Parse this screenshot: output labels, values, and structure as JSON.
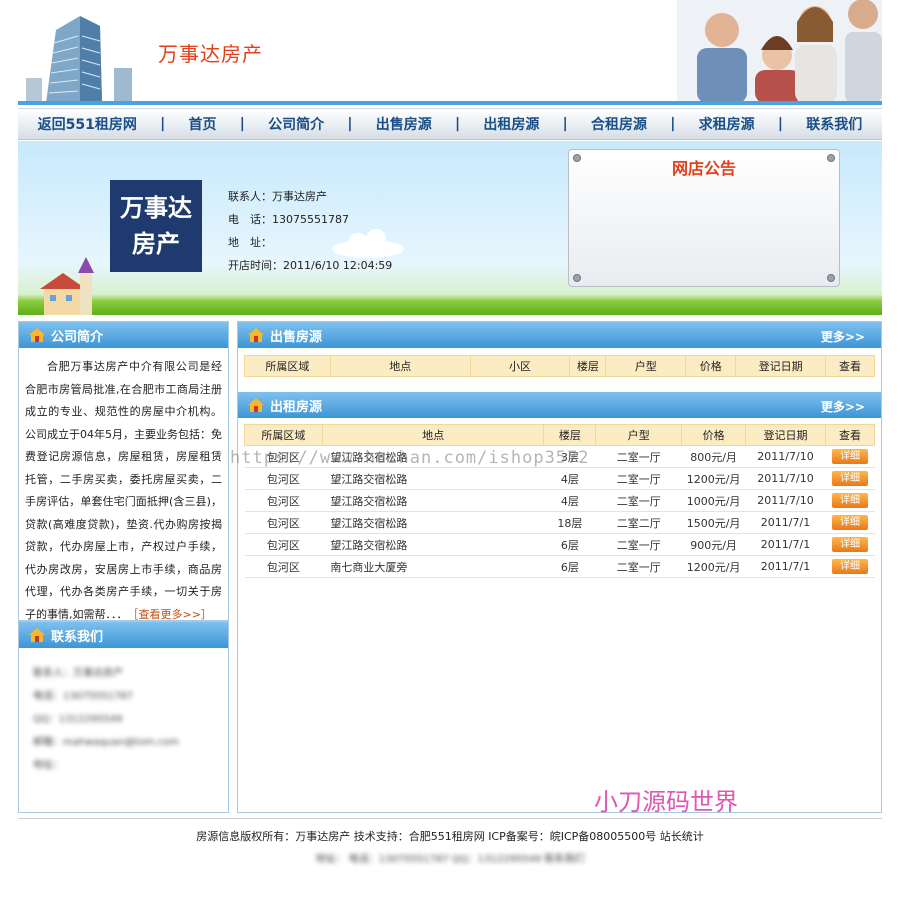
{
  "header": {
    "site_title": "万事达房产"
  },
  "nav": {
    "items": [
      {
        "label": "返回551租房网"
      },
      {
        "label": "首页"
      },
      {
        "label": "公司简介"
      },
      {
        "label": "出售房源"
      },
      {
        "label": "出租房源"
      },
      {
        "label": "合租房源"
      },
      {
        "label": "求租房源"
      },
      {
        "label": "联系我们"
      }
    ]
  },
  "shop": {
    "logo_line1": "万事达",
    "logo_line2": "房产",
    "contact_label": "联系人：",
    "contact_value": "万事达房产",
    "phone_label": "电　话：",
    "phone_value": "13075551787",
    "address_label": "地　址：",
    "address_value": "",
    "opened_label": "开店时间：",
    "opened_value": "2011/6/10 12:04:59"
  },
  "notice": {
    "title": "网店公告"
  },
  "about": {
    "title": "公司简介",
    "text": "合肥万事达房产中介有限公司是经合肥市房管局批准,在合肥市工商局注册成立的专业、规范性的房屋中介机构。公司成立于04年5月，主要业务包括：免费登记房源信息，房屋租赁，房屋租赁托管，二手房买卖，委托房屋买卖，二手房评估，单套住宅门面抵押(含三县)，贷款(高难度贷款)，垫资.代办购房按揭贷款，代办房屋上市，产权过户手续，代办房改房，安居房上市手续，商品房代理，代办各类房产手续，一切关于房子的事情,如需帮．．．",
    "more_label": "［查看更多>>］"
  },
  "contact": {
    "title": "联系我们",
    "lines": [
      "联系人：万事达房产",
      "电话：13075551787",
      "QQ：1312295549",
      "邮箱：mahwaquan@tom.com",
      "地址："
    ]
  },
  "sale": {
    "title": "出售房源",
    "more_label": "更多>>",
    "columns": [
      "所属区域",
      "地点",
      "小区",
      "楼层",
      "户型",
      "价格",
      "登记日期",
      "查看"
    ]
  },
  "rent": {
    "title": "出租房源",
    "more_label": "更多>>",
    "columns": [
      "所属区域",
      "地点",
      "楼层",
      "户型",
      "价格",
      "登记日期",
      "查看"
    ],
    "detail_label": "详细",
    "rows": [
      {
        "district": "包河区",
        "location": "望江路交宿松路",
        "floor": "3层",
        "layout": "二室一厅",
        "price": "800元/月",
        "date": "2011/7/10"
      },
      {
        "district": "包河区",
        "location": "望江路交宿松路",
        "floor": "4层",
        "layout": "二室一厅",
        "price": "1200元/月",
        "date": "2011/7/10"
      },
      {
        "district": "包河区",
        "location": "望江路交宿松路",
        "floor": "4层",
        "layout": "二室一厅",
        "price": "1000元/月",
        "date": "2011/7/10"
      },
      {
        "district": "包河区",
        "location": "望江路交宿松路",
        "floor": "18层",
        "layout": "二室二厅",
        "price": "1500元/月",
        "date": "2011/7/1"
      },
      {
        "district": "包河区",
        "location": "望江路交宿松路",
        "floor": "6层",
        "layout": "二室一厅",
        "price": "900元/月",
        "date": "2011/7/1"
      },
      {
        "district": "包河区",
        "location": "南七商业大厦旁",
        "floor": "6层",
        "layout": "二室一厅",
        "price": "1200元/月",
        "date": "2011/7/1"
      }
    ]
  },
  "watermark": "https://www.huzhan.com/ishop3572",
  "brand_mark": "小刀源码世界",
  "footer": {
    "copyright": "房源信息版权所有：万事达房产  技术支持：合肥551租房网  ICP备案号：皖ICP备08005500号 站长统计",
    "contact_line": "地址：  电话：13075551787 QQ：1312295549  联系我们"
  },
  "colors": {
    "accent": "#3d95d6",
    "title_red": "#e0401a",
    "nav_text": "#1a4e86",
    "button_orange": "#e8791a"
  }
}
